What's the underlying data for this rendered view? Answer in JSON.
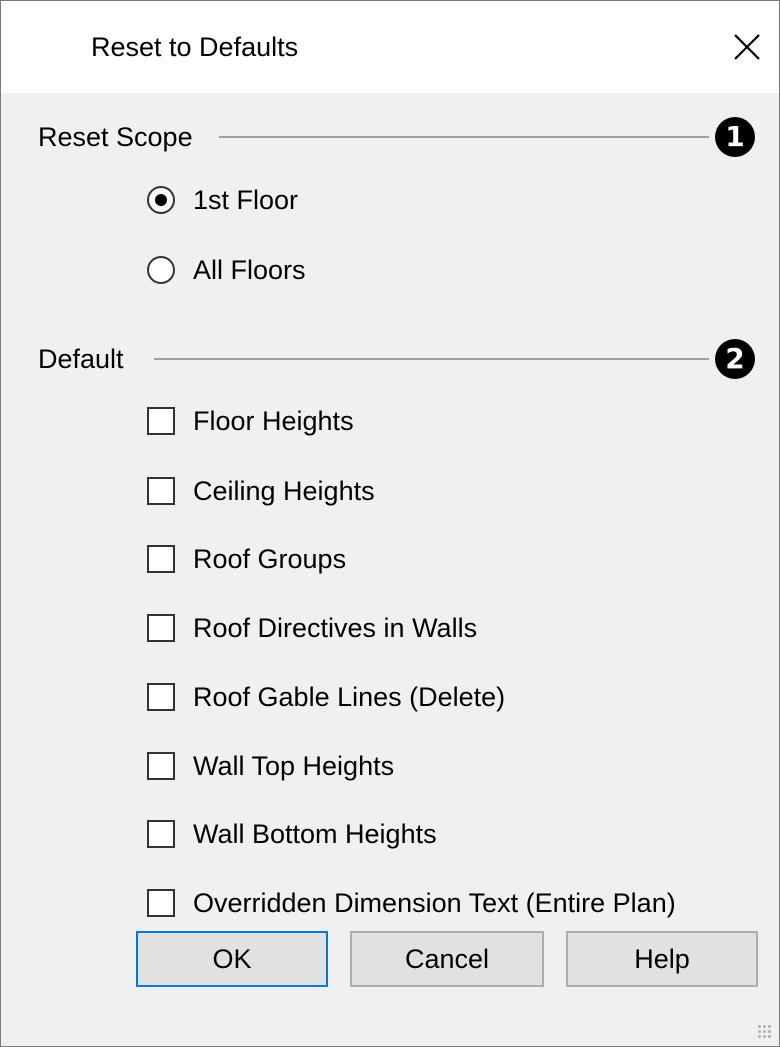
{
  "window": {
    "title": "Reset to Defaults",
    "close_icon": "close-icon"
  },
  "scope_group": {
    "label": "Reset Scope",
    "marker": "1",
    "options": [
      {
        "label": "1st Floor",
        "selected": true
      },
      {
        "label": "All Floors",
        "selected": false
      }
    ]
  },
  "default_group": {
    "label": "Default",
    "marker": "2",
    "options": [
      {
        "label": "Floor Heights",
        "checked": false
      },
      {
        "label": "Ceiling Heights",
        "checked": false
      },
      {
        "label": "Roof Groups",
        "checked": false
      },
      {
        "label": "Roof Directives in Walls",
        "checked": false
      },
      {
        "label": "Roof Gable Lines (Delete)",
        "checked": false
      },
      {
        "label": "Wall Top Heights",
        "checked": false
      },
      {
        "label": "Wall Bottom Heights",
        "checked": false
      },
      {
        "label": "Overridden Dimension Text (Entire Plan)",
        "checked": false
      }
    ]
  },
  "buttons": {
    "ok": "OK",
    "cancel": "Cancel",
    "help": "Help"
  },
  "colors": {
    "default_button_border": "#0078d7",
    "dialog_background": "#f0f0f0",
    "titlebar_background": "#ffffff"
  }
}
